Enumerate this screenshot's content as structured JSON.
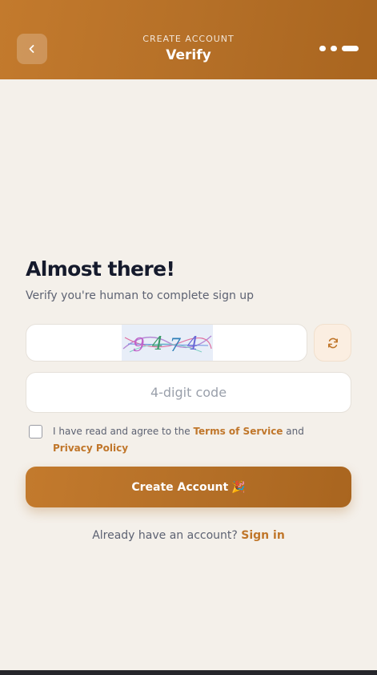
{
  "header": {
    "subtitle": "CREATE ACCOUNT",
    "title": "Verify",
    "back_icon": "chevron-left-icon",
    "steps": [
      "done",
      "done",
      "active"
    ],
    "gradient_start": "#c37a2d",
    "gradient_end": "#a9651f"
  },
  "main": {
    "heading": "Almost there!",
    "subheading": "Verify you're human to complete sign up",
    "captcha": {
      "code": "9474",
      "refresh_icon": "refresh-icon"
    },
    "code_input": {
      "value": "",
      "placeholder": "4-digit code"
    },
    "agreement": {
      "checked": false,
      "text_before": "I have read and agree to the ",
      "terms_link": "Terms of Service",
      "text_middle": " and ",
      "privacy_link": "Privacy Policy"
    },
    "create_button": {
      "label": "Create Account",
      "icon": "🎉"
    },
    "signin": {
      "prompt": "Already have an account? ",
      "link": "Sign in"
    }
  },
  "colors": {
    "accent": "#c0762a",
    "background": "#f4f0ea",
    "heading": "#151a2c",
    "muted": "#5d6272"
  }
}
